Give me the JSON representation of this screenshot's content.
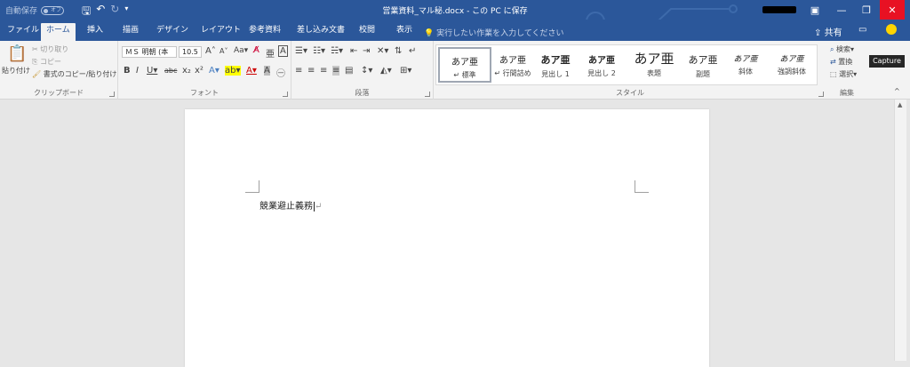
{
  "window": {
    "autosave_label": "自動保存",
    "autosave_state": "オフ",
    "doc_title": "営業資料_マル秘.docx - この PC に保存",
    "minimize_icon": "—",
    "restore_icon": "❐",
    "close_icon": "✕"
  },
  "tabs": [
    "ファイル",
    "ホーム",
    "挿入",
    "描画",
    "デザイン",
    "レイアウト",
    "参考資料",
    "差し込み文書",
    "校閲",
    "表示"
  ],
  "tell_me": "実行したい作業を入力してください",
  "share_label": "共有",
  "clipboard": {
    "paste": "貼り付け",
    "cut": "切り取り",
    "copy": "コピー",
    "format_painter": "書式のコピー/貼り付け",
    "label": "クリップボード"
  },
  "font": {
    "name": "ＭＳ 明朝 (本",
    "size": "10.5",
    "label": "フォント"
  },
  "paragraph": {
    "label": "段落"
  },
  "styles": {
    "label": "スタイル",
    "items": [
      {
        "preview": "あア亜",
        "name": "標準"
      },
      {
        "preview": "あア亜",
        "name": "行間詰め"
      },
      {
        "preview": "あア亜",
        "name": "見出し 1"
      },
      {
        "preview": "あア亜",
        "name": "見出し 2"
      },
      {
        "preview": "あア亜",
        "name": "表題"
      },
      {
        "preview": "あア亜",
        "name": "副題"
      },
      {
        "preview": "あア亜",
        "name": "斜体"
      },
      {
        "preview": "あア亜",
        "name": "強調斜体"
      }
    ]
  },
  "editing": {
    "find": "検索",
    "replace": "置換",
    "select": "選択",
    "label": "編集"
  },
  "capture_tooltip": "Capture",
  "document": {
    "body_text": "競業避止義務"
  }
}
